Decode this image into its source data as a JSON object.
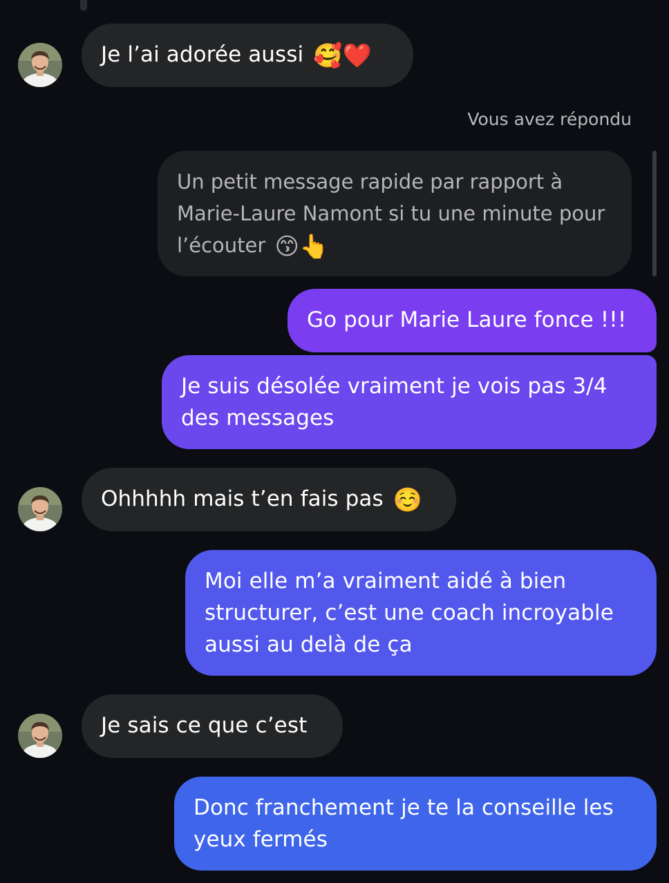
{
  "conversation": {
    "reply_label": "Vous avez répondu",
    "quoted_message": {
      "text": "Un petit message rapide par rapport à Marie-Laure Namont si tu une minute pour l’écouter",
      "emojis": "😙👆"
    },
    "messages": [
      {
        "sender": "contact",
        "text": "Je l’ai adorée aussi",
        "emojis": "🥰❤️"
      },
      {
        "sender": "me",
        "text": "Go pour Marie Laure fonce !!!"
      },
      {
        "sender": "me",
        "text": "Je suis désolée vraiment je vois pas 3/4 des messages"
      },
      {
        "sender": "contact",
        "text": "Ohhhhh mais t’en fais pas",
        "emojis": "☺️"
      },
      {
        "sender": "me",
        "text": "Moi elle m’a vraiment aidé à bien structurer, c’est une coach incroyable aussi au delà de ça"
      },
      {
        "sender": "contact",
        "text": "Je sais ce que c’est"
      },
      {
        "sender": "me",
        "text": "Donc franchement je te la conseille les yeux fermés"
      }
    ]
  },
  "colors": {
    "background": "#0b0d12",
    "incoming_bubble": "#242527",
    "outgoing_gradient_top": "#7a3cf0",
    "outgoing_gradient_bottom": "#3d63ea"
  },
  "icons": {
    "avatar": "contact-avatar-photo"
  }
}
